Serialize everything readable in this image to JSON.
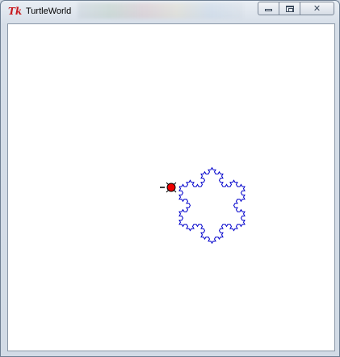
{
  "window": {
    "title": "TurtleWorld",
    "app_icon": "tk-icon",
    "app_icon_text": "Tk",
    "buttons": [
      {
        "name": "minimize-button",
        "icon": "minimize-icon"
      },
      {
        "name": "maximize-button",
        "icon": "maximize-icon"
      },
      {
        "name": "close-button",
        "icon": "close-icon",
        "glyph": "✕"
      }
    ]
  },
  "canvas": {
    "background": "#ffffff",
    "drawing": {
      "shape": "koch-snowflake",
      "level": 3,
      "stroke_color": "#0000cc"
    },
    "turtle": {
      "body_color": "#ee0000",
      "outline_color": "#000000",
      "heading": "left"
    }
  }
}
